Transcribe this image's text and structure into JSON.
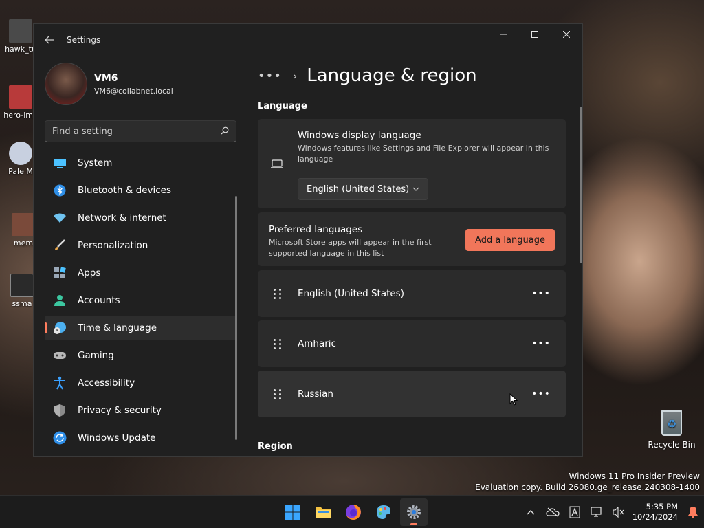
{
  "desktop": {
    "icons": [
      {
        "label": "hawk_tu",
        "color": "#4a4a4a"
      },
      {
        "label": "hero-ima",
        "color": "#b83a3a"
      },
      {
        "label": "Pale M",
        "color": "#c8d0e0"
      },
      {
        "label": "mem",
        "color": "#7a4a3a"
      },
      {
        "label": "ssma",
        "color": "#2a2a2a"
      }
    ],
    "recycle_bin": "Recycle Bin",
    "watermark_line1": "Windows 11 Pro Insider Preview",
    "watermark_line2": "Evaluation copy. Build 26080.ge_release.240308-1400"
  },
  "window": {
    "title": "Settings",
    "back_icon": "back-arrow-icon",
    "controls": [
      "minimize",
      "maximize",
      "close"
    ]
  },
  "profile": {
    "name": "VM6",
    "email": "VM6@collabnet.local"
  },
  "search": {
    "placeholder": "Find a setting"
  },
  "nav": [
    {
      "label": "System",
      "icon": "system-icon",
      "color": "#4cc2ff"
    },
    {
      "label": "Bluetooth & devices",
      "icon": "bluetooth-icon",
      "color": "#2f8fe8"
    },
    {
      "label": "Network & internet",
      "icon": "network-icon",
      "color": "#6fc3f0"
    },
    {
      "label": "Personalization",
      "icon": "brush-icon",
      "color": "#e8a64a"
    },
    {
      "label": "Apps",
      "icon": "apps-icon",
      "color": "#9aa8b8"
    },
    {
      "label": "Accounts",
      "icon": "accounts-icon",
      "color": "#3cc7a0"
    },
    {
      "label": "Time & language",
      "icon": "time-language-icon",
      "color": "#4cb0f0",
      "active": true
    },
    {
      "label": "Gaming",
      "icon": "gaming-icon",
      "color": "#b8b8b8"
    },
    {
      "label": "Accessibility",
      "icon": "accessibility-icon",
      "color": "#3aa0ff"
    },
    {
      "label": "Privacy & security",
      "icon": "shield-icon",
      "color": "#8a8a8a"
    },
    {
      "label": "Windows Update",
      "icon": "update-icon",
      "color": "#2f8fe8"
    }
  ],
  "content": {
    "breadcrumb_more": "•••",
    "title": "Language & region",
    "language_section": "Language",
    "display_language": {
      "title": "Windows display language",
      "desc": "Windows features like Settings and File Explorer will appear in this language",
      "value": "English (United States)"
    },
    "preferred": {
      "title": "Preferred languages",
      "desc": "Microsoft Store apps will appear in the first supported language in this list",
      "button": "Add a language"
    },
    "languages": [
      "English (United States)",
      "Amharic",
      "Russian"
    ],
    "more_label": "•••",
    "region_section": "Region"
  },
  "taskbar": {
    "apps": [
      "start",
      "file-explorer",
      "firefox",
      "paint",
      "settings"
    ],
    "active_app": "settings",
    "time": "5:35 PM",
    "date": "10/24/2024"
  },
  "colors": {
    "accent": "#ff7d5e",
    "button": "#f1765a",
    "card": "#2b2b2b",
    "window": "#202020"
  }
}
